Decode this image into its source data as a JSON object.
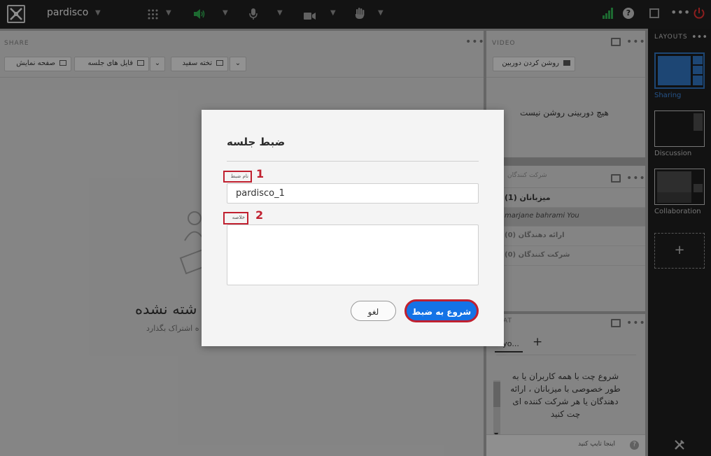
{
  "topbar": {
    "app_name": "pardisco",
    "icons": [
      "app-logo-icon",
      "grid-icon",
      "speaker-icon",
      "mic-icon",
      "camera-icon",
      "hand-raise-icon",
      "signal-bars-icon",
      "help-icon",
      "fullscreen-icon",
      "more-icon",
      "power-icon"
    ]
  },
  "share_pod": {
    "title": "SHARE",
    "buttons": [
      "صفحه نمایش",
      "فایل های جلسه",
      "تخته سفید"
    ],
    "empty_title": "شته نشده",
    "empty_subtitle": "ه اشتراک بگذارد"
  },
  "video_pod": {
    "title": "VIDEO",
    "camera_button": "روشن کردن دوربین",
    "no_camera": "هیچ دوربینی روشن نیست"
  },
  "attendees_pod": {
    "title": "شرکت کنندگان",
    "rows": [
      "میزبانان (1)",
      "marjane bahrami You",
      "ارائه دهندگان (0)",
      "شرکت کنندگان (0)"
    ]
  },
  "chat_pod": {
    "title": "AT",
    "tab_label": "eryo...",
    "add_tab": "+",
    "intro": "شروع چت با همه کاربران یا به طور خصوصی با میزبانان ، ارائه دهندگان یا هر شرکت کننده ای چت کنید",
    "input_placeholder": "اینجا تایپ کنید"
  },
  "layouts_panel": {
    "title": "LAYOUTS",
    "items": [
      "Sharing",
      "Discussion",
      "Collaboration"
    ],
    "add": "+",
    "accent": "#2f6fb8"
  },
  "dialog": {
    "title": "ضبط جلسه",
    "name_label": "نام ضبط",
    "name_value": "pardisco_1",
    "summary_label": "خلاصه",
    "summary_value": "",
    "marker_1": "1",
    "marker_2": "2",
    "cancel_label": "لغو",
    "start_label": "شروع به ضبط",
    "primary_color": "#1473e6",
    "highlight_color": "#c0202f"
  }
}
